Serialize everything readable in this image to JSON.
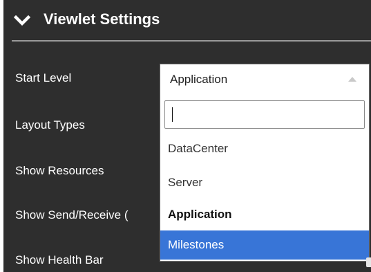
{
  "header": {
    "title": "Viewlet Settings",
    "toggle_icon": "chevron-down-icon"
  },
  "settings": {
    "start_level_label": "Start Level",
    "layout_types_label": "Layout Types",
    "show_resources_label": "Show Resources",
    "show_send_receive_label": "Show Send/Receive (",
    "show_health_bar_label": "Show Health Bar"
  },
  "start_level_select": {
    "value": "Application",
    "search_value": "",
    "options": [
      {
        "label": "DataCenter",
        "state": "normal"
      },
      {
        "label": "Server",
        "state": "normal"
      },
      {
        "label": "Application",
        "state": "selected"
      },
      {
        "label": "Milestones",
        "state": "highlighted"
      }
    ]
  },
  "colors": {
    "panel_background": "#2e2e2e",
    "highlight": "#3875d7",
    "text_light": "#ffffff"
  }
}
